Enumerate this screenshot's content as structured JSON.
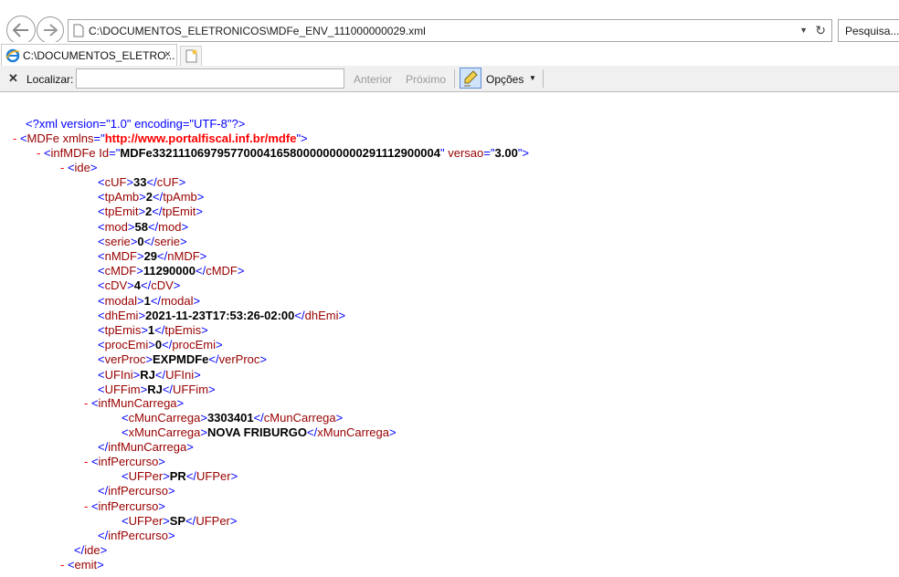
{
  "browser": {
    "address": "C:\\DOCUMENTOS_ELETRONICOS\\MDFe_ENV_111000000029.xml",
    "search_placeholder": "Pesquisa...",
    "tab_title": "C:\\DOCUMENTOS_ELETRO...",
    "find": {
      "label": "Localizar:",
      "value": "",
      "prev": "Anterior",
      "next": "Próximo",
      "options": "Opções"
    }
  },
  "xml": {
    "declaration": "<?xml version=\"1.0\" encoding=\"UTF-8\"?>",
    "root": {
      "tag": "MDFe",
      "attr": "xmlns",
      "value": "http://www.portalfiscal.inf.br/mdfe"
    },
    "inf": {
      "tag": "infMDFe",
      "attr1": "Id",
      "val1": "MDFe33211106979577000416580000000000291112900004",
      "attr2": "versao",
      "val2": "3.00"
    },
    "ide_tag": "ide",
    "ide_fields": [
      {
        "tag": "cUF",
        "value": "33"
      },
      {
        "tag": "tpAmb",
        "value": "2"
      },
      {
        "tag": "tpEmit",
        "value": "2"
      },
      {
        "tag": "mod",
        "value": "58"
      },
      {
        "tag": "serie",
        "value": "0"
      },
      {
        "tag": "nMDF",
        "value": "29"
      },
      {
        "tag": "cMDF",
        "value": "11290000"
      },
      {
        "tag": "cDV",
        "value": "4"
      },
      {
        "tag": "modal",
        "value": "1"
      },
      {
        "tag": "dhEmi",
        "value": "2021-11-23T17:53:26-02:00"
      },
      {
        "tag": "tpEmis",
        "value": "1"
      },
      {
        "tag": "procEmi",
        "value": "0"
      },
      {
        "tag": "verProc",
        "value": "EXPMDFe"
      },
      {
        "tag": "UFIni",
        "value": "RJ"
      },
      {
        "tag": "UFFim",
        "value": "RJ"
      }
    ],
    "infMunCarrega": {
      "tag": "infMunCarrega",
      "cMun": {
        "tag": "cMunCarrega",
        "value": "3303401"
      },
      "xMun": {
        "tag": "xMunCarrega",
        "value": "NOVA FRIBURGO"
      }
    },
    "percursos": [
      {
        "tag": "infPercurso",
        "uf_tag": "UFPer",
        "value": "PR"
      },
      {
        "tag": "infPercurso",
        "uf_tag": "UFPer",
        "value": "SP"
      }
    ],
    "ide_close": "ide",
    "emit_tag": "emit"
  }
}
